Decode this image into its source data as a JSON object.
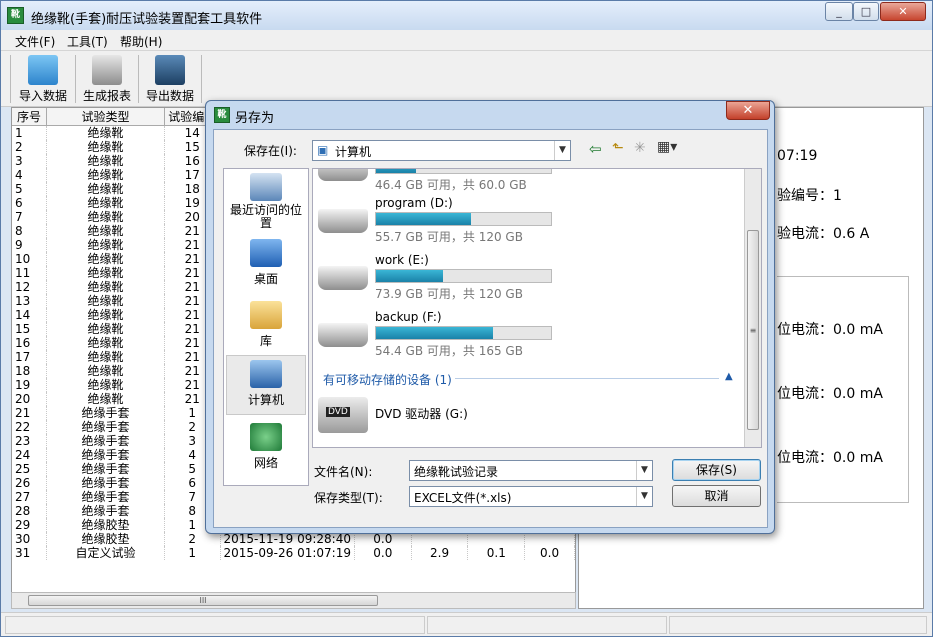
{
  "app": {
    "title": "绝缘靴(手套)耐压试验装置配套工具软件",
    "icon_text": "靴",
    "min_label": "□",
    "max_label": "□",
    "close_label": "✕"
  },
  "menu": [
    "文件(F)",
    "工具(T)",
    "帮助(H)"
  ],
  "toolbar": [
    {
      "label": "导入数据",
      "icon": "import-icon",
      "color": "#3a9be0"
    },
    {
      "label": "生成报表",
      "icon": "printer-icon",
      "color": "#8a8a8a"
    },
    {
      "label": "导出数据",
      "icon": "export-icon",
      "color": "#2f5a86"
    }
  ],
  "grid": {
    "headers": [
      "序号",
      "试验类型",
      "试验编号",
      "",
      "",
      "",
      "",
      ""
    ],
    "rows": [
      [
        "1",
        "绝缘靴",
        "14",
        "",
        "",
        "",
        "",
        ""
      ],
      [
        "2",
        "绝缘靴",
        "15",
        "",
        "",
        "",
        "",
        ""
      ],
      [
        "3",
        "绝缘靴",
        "16",
        "",
        "",
        "",
        "",
        ""
      ],
      [
        "4",
        "绝缘靴",
        "17",
        "",
        "",
        "",
        "",
        ""
      ],
      [
        "5",
        "绝缘靴",
        "18",
        "",
        "",
        "",
        "",
        ""
      ],
      [
        "6",
        "绝缘靴",
        "19",
        "",
        "",
        "",
        "",
        ""
      ],
      [
        "7",
        "绝缘靴",
        "20",
        "",
        "",
        "",
        "",
        ""
      ],
      [
        "8",
        "绝缘靴",
        "21",
        "",
        "",
        "",
        "",
        ""
      ],
      [
        "9",
        "绝缘靴",
        "21",
        "",
        "",
        "",
        "",
        ""
      ],
      [
        "10",
        "绝缘靴",
        "21",
        "",
        "",
        "",
        "",
        ""
      ],
      [
        "11",
        "绝缘靴",
        "21",
        "",
        "",
        "",
        "",
        ""
      ],
      [
        "12",
        "绝缘靴",
        "21",
        "",
        "",
        "",
        "",
        ""
      ],
      [
        "13",
        "绝缘靴",
        "21",
        "",
        "",
        "",
        "",
        ""
      ],
      [
        "14",
        "绝缘靴",
        "21",
        "",
        "",
        "",
        "",
        ""
      ],
      [
        "15",
        "绝缘靴",
        "21",
        "",
        "",
        "",
        "",
        ""
      ],
      [
        "16",
        "绝缘靴",
        "21",
        "",
        "",
        "",
        "",
        ""
      ],
      [
        "17",
        "绝缘靴",
        "21",
        "",
        "",
        "",
        "",
        ""
      ],
      [
        "18",
        "绝缘靴",
        "21",
        "",
        "",
        "",
        "",
        ""
      ],
      [
        "19",
        "绝缘靴",
        "21",
        "",
        "",
        "",
        "",
        ""
      ],
      [
        "20",
        "绝缘靴",
        "21",
        "",
        "",
        "",
        "",
        ""
      ],
      [
        "21",
        "绝缘手套",
        "1",
        "",
        "",
        "",
        "",
        ""
      ],
      [
        "22",
        "绝缘手套",
        "2",
        "",
        "",
        "",
        "",
        ""
      ],
      [
        "23",
        "绝缘手套",
        "3",
        "",
        "",
        "",
        "",
        ""
      ],
      [
        "24",
        "绝缘手套",
        "4",
        "",
        "",
        "",
        "",
        ""
      ],
      [
        "25",
        "绝缘手套",
        "5",
        "",
        "",
        "",
        "",
        ""
      ],
      [
        "26",
        "绝缘手套",
        "6",
        "",
        "",
        "",
        "",
        ""
      ],
      [
        "27",
        "绝缘手套",
        "7",
        "",
        "",
        "",
        "",
        ""
      ],
      [
        "28",
        "绝缘手套",
        "8",
        "",
        "",
        "",
        "",
        ""
      ],
      [
        "29",
        "绝缘胶垫",
        "1",
        "",
        "",
        "",
        "",
        ""
      ],
      [
        "30",
        "绝缘胶垫",
        "2",
        "2015-11-19 09:28:40",
        "0.0",
        "",
        "",
        ""
      ],
      [
        "31",
        "自定义试验",
        "1",
        "2015-09-26 01:07:19",
        "0.0",
        "2.9",
        "0.1",
        "0.0"
      ]
    ]
  },
  "hscroll_grip": "III",
  "right": {
    "time": "07:19",
    "test_no": "验编号：1",
    "test_current": "验电流：0.6 A",
    "pos1": "位电流：0.0 mA",
    "pos2": "位电流：0.0 mA",
    "pos3": "位电流：0.0 mA"
  },
  "dialog": {
    "title": "另存为",
    "icon_text": "靴",
    "close_label": "✕",
    "save_in_label": "保存在(I):",
    "save_in_value": "计算机",
    "places": [
      {
        "label": "最近访问的位置",
        "icon": "recent-places-icon",
        "color": "#5b86b8"
      },
      {
        "label": "桌面",
        "icon": "desktop-icon",
        "color": "#2a6cc0"
      },
      {
        "label": "库",
        "icon": "libraries-icon",
        "color": "#e8b84a"
      },
      {
        "label": "计算机",
        "icon": "computer-icon",
        "color": "#3a7cc4"
      },
      {
        "label": "网络",
        "icon": "network-icon",
        "color": "#2d9a4a"
      }
    ],
    "drives": [
      {
        "name": "",
        "free": "46.4 GB 可用，共 60.0 GB",
        "fraction": 0.23
      },
      {
        "name": "program (D:)",
        "free": "55.7 GB 可用，共 120 GB",
        "fraction": 0.54
      },
      {
        "name": "work (E:)",
        "free": "73.9 GB 可用，共 120 GB",
        "fraction": 0.38
      },
      {
        "name": "backup (F:)",
        "free": "54.4 GB 可用，共 165 GB",
        "fraction": 0.67
      }
    ],
    "removable_header": "有可移动存储的设备 (1)",
    "dvd": {
      "name": "DVD 驱动器 (G:)",
      "badge": "DVD"
    },
    "vscroll_grip": "≡",
    "filename_label": "文件名(N):",
    "filename_value": "绝缘靴试验记录",
    "type_label": "保存类型(T):",
    "type_value": "EXCEL文件(*.xls)",
    "save_button": "保存(S)",
    "cancel_button": "取消"
  }
}
